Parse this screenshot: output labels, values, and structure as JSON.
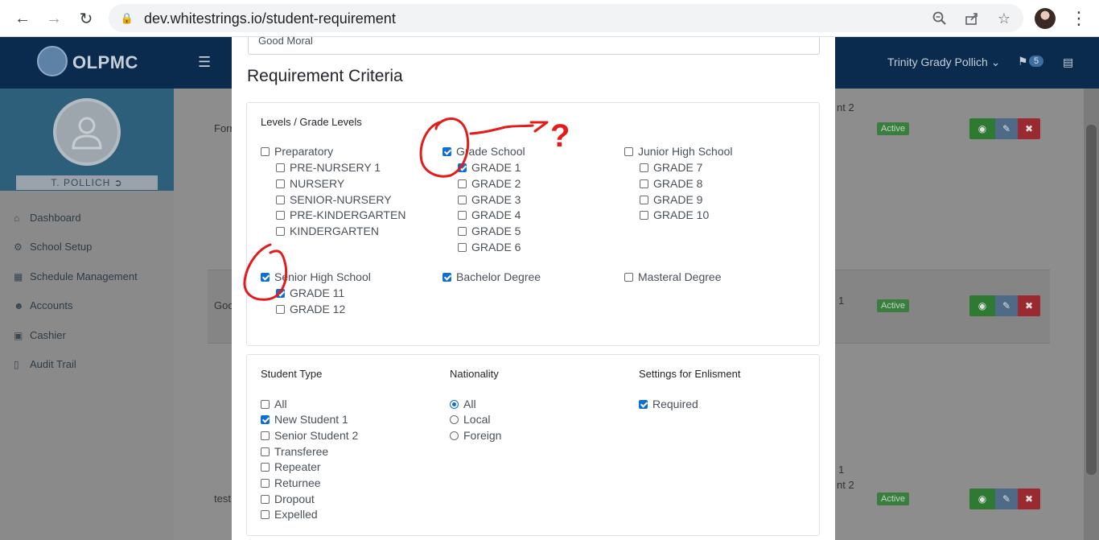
{
  "browser": {
    "url": "dev.whitestrings.io/student-requirement"
  },
  "app": {
    "logo": "OLPMC",
    "user_name": "Trinity Grady Pollich",
    "notifications_count": "5",
    "profile_name": "T. POLLICH"
  },
  "sidebar": {
    "items": [
      {
        "label": "Dashboard",
        "icon": "home-icon"
      },
      {
        "label": "School Setup",
        "icon": "gear-icon"
      },
      {
        "label": "Schedule Management",
        "icon": "calendar-icon"
      },
      {
        "label": "Accounts",
        "icon": "users-icon"
      },
      {
        "label": "Cashier",
        "icon": "cash-icon"
      },
      {
        "label": "Audit Trail",
        "icon": "file-icon"
      }
    ]
  },
  "background_rows": [
    {
      "name_fragment": "Forr",
      "grade_fragment": "nt 2",
      "status": "Active"
    },
    {
      "name_fragment": "Goo",
      "grade_fragment": "1",
      "status": "Active"
    },
    {
      "name_fragment": "test",
      "grade_fragment": "1",
      "grade_fragment2": "nt 2",
      "status": "Active"
    }
  ],
  "modal": {
    "previous_field_value": "Good Moral",
    "title": "Requirement Criteria",
    "levels": {
      "heading": "Levels / Grade Levels",
      "groups": [
        {
          "label": "Preparatory",
          "checked": false,
          "children": [
            {
              "label": "PRE-NURSERY 1",
              "checked": false
            },
            {
              "label": "NURSERY",
              "checked": false
            },
            {
              "label": "SENIOR-NURSERY",
              "checked": false
            },
            {
              "label": "PRE-KINDERGARTEN",
              "checked": false
            },
            {
              "label": "KINDERGARTEN",
              "checked": false
            }
          ]
        },
        {
          "label": "Grade School",
          "checked": true,
          "children": [
            {
              "label": "GRADE 1",
              "checked": true
            },
            {
              "label": "GRADE 2",
              "checked": false
            },
            {
              "label": "GRADE 3",
              "checked": false
            },
            {
              "label": "GRADE 4",
              "checked": false
            },
            {
              "label": "GRADE 5",
              "checked": false
            },
            {
              "label": "GRADE 6",
              "checked": false
            }
          ]
        },
        {
          "label": "Junior High School",
          "checked": false,
          "children": [
            {
              "label": "GRADE 7",
              "checked": false
            },
            {
              "label": "GRADE 8",
              "checked": false
            },
            {
              "label": "GRADE 9",
              "checked": false
            },
            {
              "label": "GRADE 10",
              "checked": false
            }
          ]
        },
        {
          "label": "Senior High School",
          "checked": true,
          "children": [
            {
              "label": "GRADE 11",
              "checked": true
            },
            {
              "label": "GRADE 12",
              "checked": false
            }
          ]
        },
        {
          "label": "Bachelor Degree",
          "checked": true,
          "children": []
        },
        {
          "label": "Masteral Degree",
          "checked": false,
          "children": []
        }
      ]
    },
    "student_type": {
      "heading": "Student Type",
      "options": [
        {
          "label": "All",
          "checked": false
        },
        {
          "label": "New Student 1",
          "checked": true
        },
        {
          "label": "Senior Student 2",
          "checked": false
        },
        {
          "label": "Transferee",
          "checked": false
        },
        {
          "label": "Repeater",
          "checked": false
        },
        {
          "label": "Returnee",
          "checked": false
        },
        {
          "label": "Dropout",
          "checked": false
        },
        {
          "label": "Expelled",
          "checked": false
        }
      ]
    },
    "nationality": {
      "heading": "Nationality",
      "options": [
        {
          "label": "All",
          "selected": true
        },
        {
          "label": "Local",
          "selected": false
        },
        {
          "label": "Foreign",
          "selected": false
        }
      ]
    },
    "enlistment": {
      "heading": "Settings for Enlisment",
      "options": [
        {
          "label": "Required",
          "checked": true
        }
      ]
    }
  },
  "annotation": {
    "mark": "?"
  }
}
